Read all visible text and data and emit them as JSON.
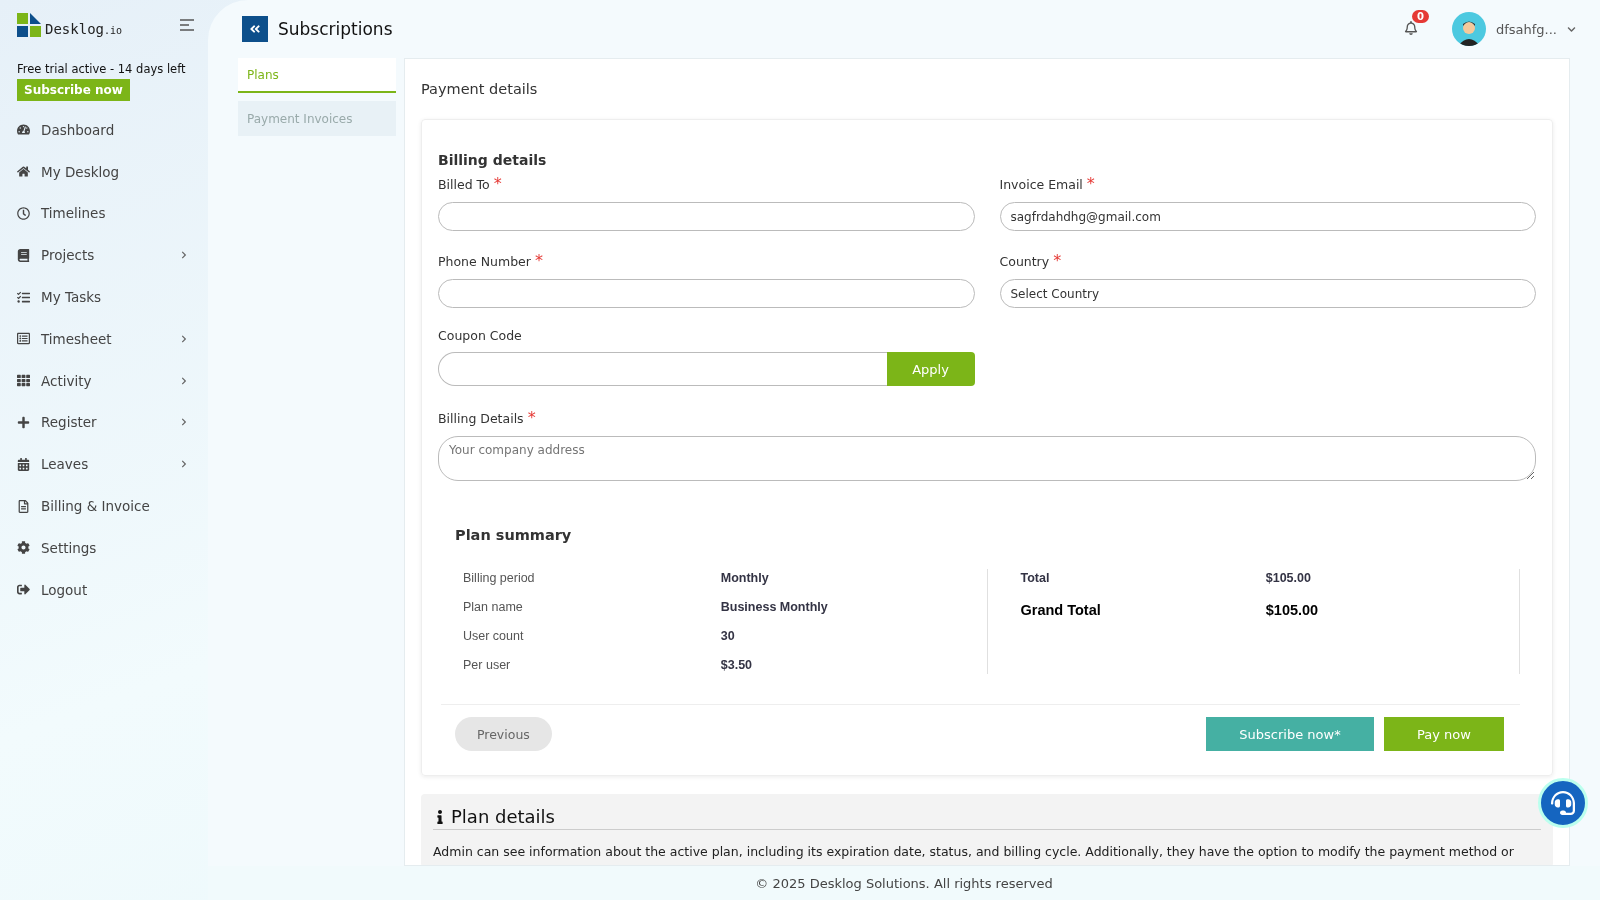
{
  "brand": {
    "name": "Desklog",
    "suffix": ".io"
  },
  "trial": {
    "text": "Free trial active - 14 days left",
    "button": "Subscribe now"
  },
  "sidebar": {
    "items": [
      {
        "label": "Dashboard",
        "has_submenu": false
      },
      {
        "label": "My Desklog",
        "has_submenu": false
      },
      {
        "label": "Timelines",
        "has_submenu": false
      },
      {
        "label": "Projects",
        "has_submenu": true
      },
      {
        "label": "My Tasks",
        "has_submenu": false
      },
      {
        "label": "Timesheet",
        "has_submenu": true
      },
      {
        "label": "Activity",
        "has_submenu": true
      },
      {
        "label": "Register",
        "has_submenu": true
      },
      {
        "label": "Leaves",
        "has_submenu": true
      },
      {
        "label": "Billing & Invoice",
        "has_submenu": false
      },
      {
        "label": "Settings",
        "has_submenu": false
      },
      {
        "label": "Logout",
        "has_submenu": false
      }
    ]
  },
  "header": {
    "title": "Subscriptions",
    "notifications": "0",
    "user": "dfsahfg..."
  },
  "tabs": [
    {
      "label": "Plans",
      "selected": true
    },
    {
      "label": "Payment Invoices",
      "selected": false
    }
  ],
  "payment": {
    "title": "Payment details",
    "billing_title": "Billing details",
    "fields": [
      {
        "label": "Billed To",
        "required_mark": "*"
      },
      {
        "label": "Invoice Email",
        "required_mark": "*",
        "value": "sagfrdahdhg@gmail.com"
      },
      {
        "label": "Phone Number",
        "required_mark": "*"
      },
      {
        "label": "Country",
        "required_mark": "*",
        "value": "Select Country"
      }
    ],
    "coupon": {
      "label": "Coupon Code",
      "button": "Apply"
    },
    "address": {
      "label": "Billing Details",
      "required_mark": "*",
      "placeholder": "Your company address"
    },
    "summary": {
      "title": "Plan summary",
      "left": [
        {
          "label": "Billing period",
          "value": "Monthly"
        },
        {
          "label": "Plan name",
          "value": "Business Monthly"
        },
        {
          "label": "User count",
          "value": "30"
        },
        {
          "label": "Per user",
          "value": "$3.50"
        }
      ],
      "right": [
        {
          "label": "Total",
          "value": "$105.00",
          "kind": "normal"
        },
        {
          "label": "Grand Total",
          "value": "$105.00",
          "kind": "grand"
        }
      ]
    },
    "buttons": {
      "previous": "Previous",
      "subscribe": "Subscribe now*",
      "pay": "Pay now"
    }
  },
  "plan_details": {
    "title": "Plan details",
    "text": "Admin can see information about the active plan, including its expiration date, status, and billing cycle. Additionally, they have the option to modify the payment method or"
  },
  "footer": "© 2025 Desklog Solutions. All rights reserved"
}
